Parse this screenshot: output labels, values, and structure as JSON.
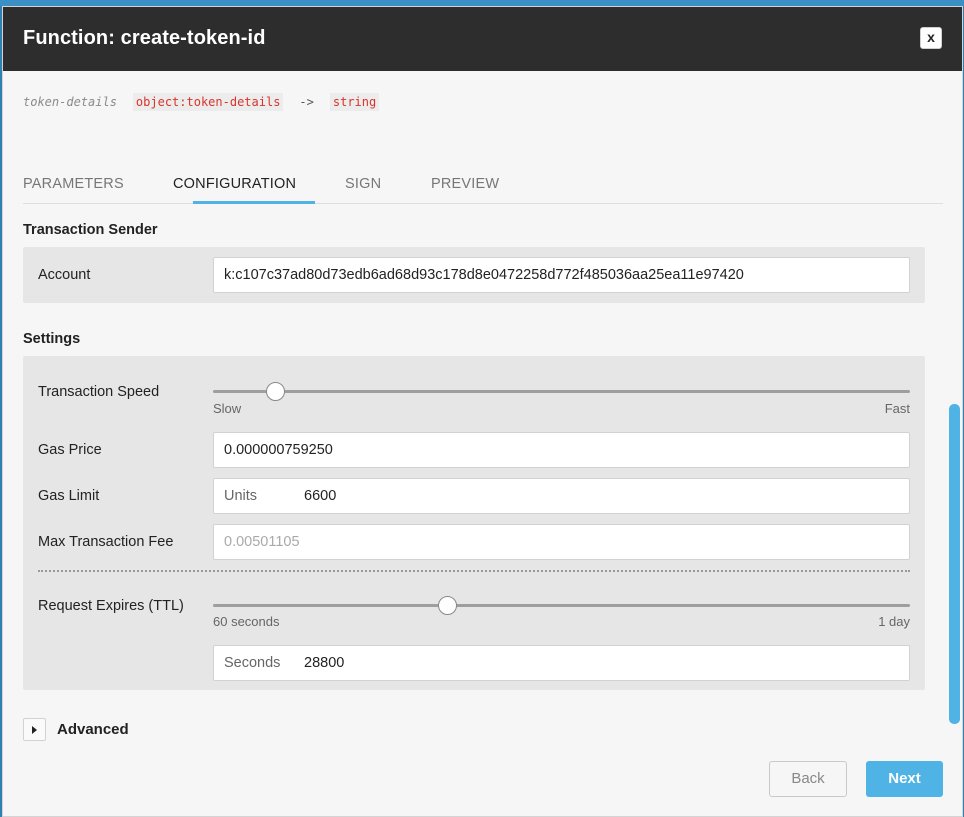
{
  "dialog": {
    "title": "Function: create-token-id",
    "close_label": "x"
  },
  "signature": {
    "param_name": "token-details",
    "param_type": "object:token-details",
    "arrow": "->",
    "return_type": "string"
  },
  "tabs": [
    {
      "label": "PARAMETERS"
    },
    {
      "label": "CONFIGURATION",
      "active": true
    },
    {
      "label": "SIGN"
    },
    {
      "label": "PREVIEW"
    }
  ],
  "sender": {
    "section_title": "Transaction Sender",
    "account_label": "Account",
    "account_value": "k:c107c37ad80d73edb6ad68d93c178d8e0472258d772f485036aa25ea11e97420"
  },
  "settings": {
    "section_title": "Settings",
    "speed_label": "Transaction Speed",
    "speed_min_label": "Slow",
    "speed_max_label": "Fast",
    "speed_level": 0.09,
    "gas_price_label": "Gas Price",
    "gas_price_value": "0.000000759250",
    "gas_limit_label": "Gas Limit",
    "gas_limit_prefix": "Units",
    "gas_limit_value": "6600",
    "max_fee_label": "Max Transaction Fee",
    "max_fee_value": "0.00501105",
    "ttl_label": "Request Expires (TTL)",
    "ttl_min_label": "60 seconds",
    "ttl_max_label": "1 day",
    "ttl_level": 0.337,
    "ttl_prefix": "Seconds",
    "ttl_value": "28800"
  },
  "advanced": {
    "label": "Advanced"
  },
  "footer": {
    "back_label": "Back",
    "next_label": "Next"
  },
  "colors": {
    "accent": "#4fb3e6",
    "header_bg": "#2d2d2d",
    "code_red": "#d9342b"
  },
  "icons": {
    "close": "close-icon",
    "expander": "triangle-right-icon"
  }
}
